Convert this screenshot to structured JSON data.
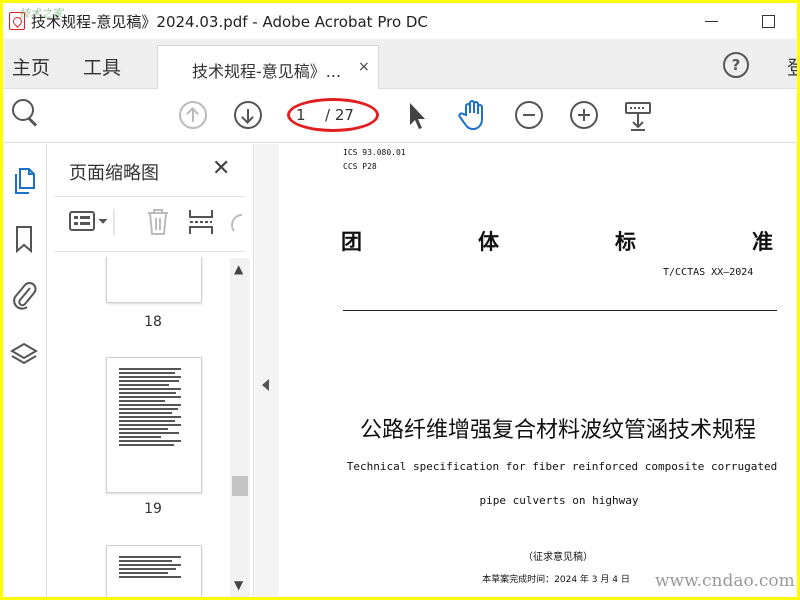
{
  "window": {
    "title": "技术规程-意见稿》2024.03.pdf - Adobe Acrobat Pro DC",
    "watermark_top_left": "技术之家"
  },
  "tabs": {
    "home": "主页",
    "tools": "工具",
    "document_tab": "技术规程-意见稿》...",
    "close_glyph": "×",
    "help_glyph": "?",
    "signin": "登"
  },
  "toolbar": {
    "current_page": "1",
    "page_total": "/ 27",
    "highlight_color": "#e02020"
  },
  "panel": {
    "title": "页面缩略图",
    "close_glyph": "✕",
    "thumbnails": [
      {
        "label": "18"
      },
      {
        "label": "19"
      },
      {
        "label": ""
      }
    ],
    "scroll_up": "▲",
    "scroll_down": "▼"
  },
  "document": {
    "ics": "ICS  93.080.01",
    "ccs": "CCS  P28",
    "header_chars": [
      "团",
      "体",
      "标",
      "准"
    ],
    "standard_number": "T/CCTAS XX—2024",
    "title": "公路纤维增强复合材料波纹管涵技术规程",
    "subtitle_line1": "Technical specification for fiber reinforced composite corrugated",
    "subtitle_line2": "pipe culverts on highway",
    "draft_label": "（征求意见稿）",
    "completion_date": "本草案完成时间：2024 年 3 月 4 日"
  },
  "watermark_bottom_right": "www.cndao.com",
  "colors": {
    "outer_border": "#ffff00",
    "tab_bar_bg": "#eeeeee",
    "hand_tool_accent": "#1a73c8",
    "pdf_icon_red": "#d22222"
  }
}
